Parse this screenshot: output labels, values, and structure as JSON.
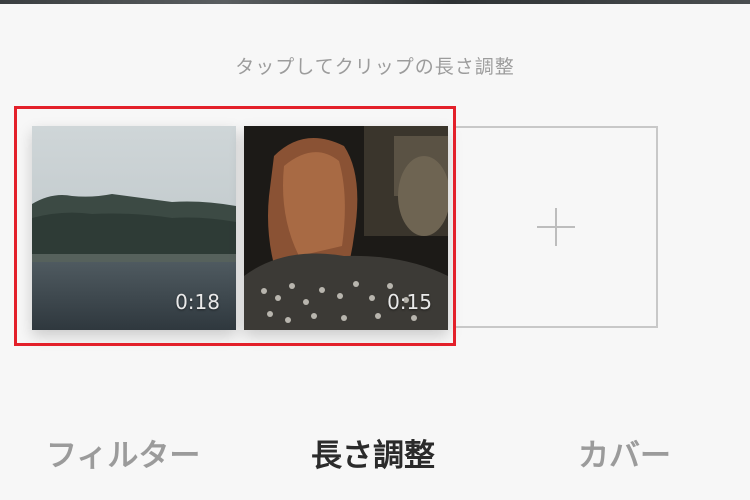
{
  "hint": "タップしてクリップの長さ調整",
  "clips": [
    {
      "duration": "0:18",
      "thumbnail": "lake-landscape"
    },
    {
      "duration": "0:15",
      "thumbnail": "person-back"
    }
  ],
  "add_clip": {
    "icon": "plus-icon"
  },
  "tabs": [
    {
      "label": "フィルター",
      "active": false
    },
    {
      "label": "長さ調整",
      "active": true
    },
    {
      "label": "カバー",
      "active": false
    }
  ],
  "colors": {
    "background": "#f7f7f7",
    "selection_frame": "#e3202a",
    "active_tab": "#2b2b2b",
    "inactive_tab": "#9b9b9b"
  }
}
